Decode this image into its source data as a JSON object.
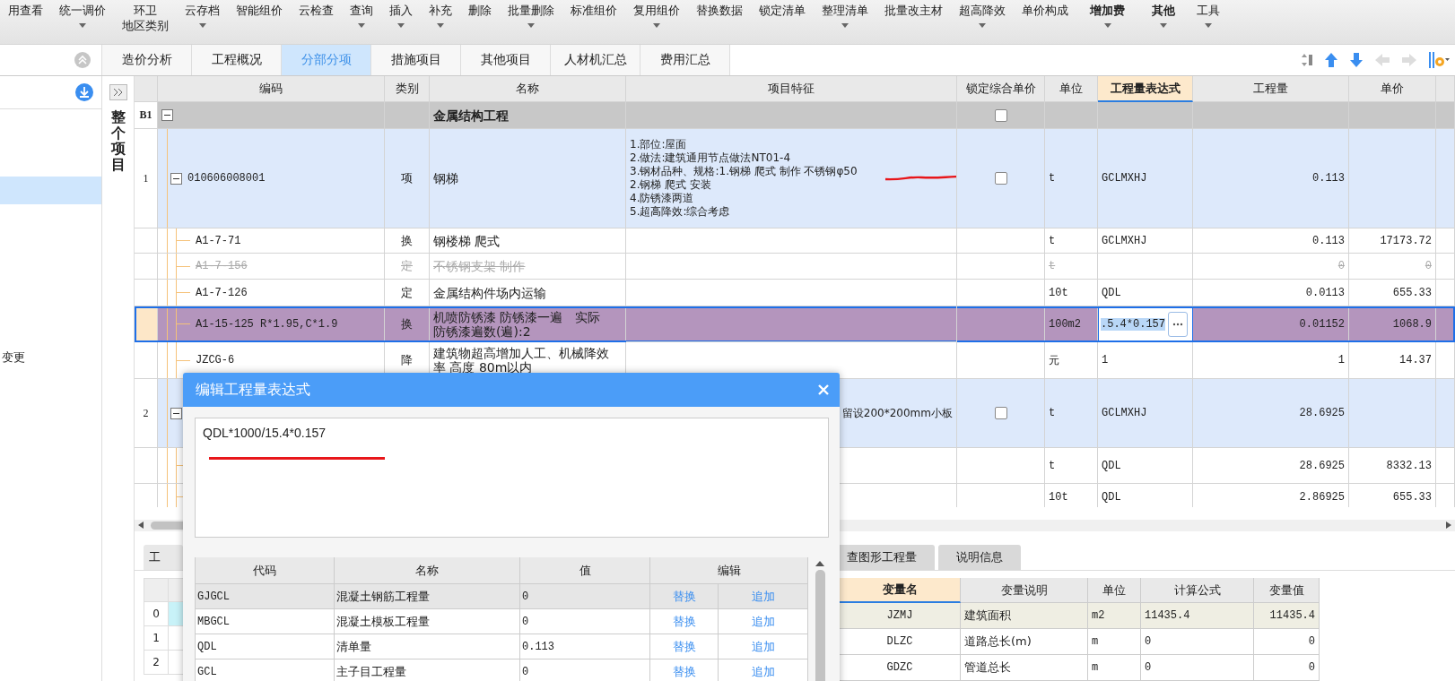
{
  "toolbar": [
    {
      "label": "用查看",
      "caret": false,
      "bold": false
    },
    {
      "label": "统一调价",
      "caret": true,
      "bold": false
    },
    {
      "label": "环卫",
      "sublabel": "地区类别",
      "caret": false,
      "bold": false
    },
    {
      "label": "云存档",
      "caret": true,
      "bold": false
    },
    {
      "label": "智能组价",
      "caret": false,
      "bold": false
    },
    {
      "label": "云检查",
      "caret": false,
      "bold": false
    },
    {
      "label": "查询",
      "caret": true,
      "bold": false
    },
    {
      "label": "插入",
      "caret": true,
      "bold": false
    },
    {
      "label": "补充",
      "caret": true,
      "bold": false
    },
    {
      "label": "删除",
      "caret": false,
      "bold": false
    },
    {
      "label": "批量删除",
      "caret": true,
      "bold": false
    },
    {
      "label": "标准组价",
      "caret": false,
      "bold": false
    },
    {
      "label": "复用组价",
      "caret": true,
      "bold": false
    },
    {
      "label": "替换数据",
      "caret": false,
      "bold": false
    },
    {
      "label": "锁定清单",
      "caret": false,
      "bold": false
    },
    {
      "label": "整理清单",
      "caret": true,
      "bold": false
    },
    {
      "label": "批量改主材",
      "caret": false,
      "bold": false
    },
    {
      "label": "超高降效",
      "caret": true,
      "bold": false
    },
    {
      "label": "单价构成",
      "caret": false,
      "bold": false
    },
    {
      "label": "增加费",
      "caret": true,
      "bold": true
    },
    {
      "label": "其他",
      "caret": true,
      "bold": true
    },
    {
      "label": "工具",
      "caret": true,
      "bold": false
    }
  ],
  "tabs": [
    {
      "label": "造价分析",
      "selected": false
    },
    {
      "label": "工程概况",
      "selected": false
    },
    {
      "label": "分部分项",
      "selected": true
    },
    {
      "label": "措施项目",
      "selected": false
    },
    {
      "label": "其他项目",
      "selected": false
    },
    {
      "label": "人材机汇总",
      "selected": false
    },
    {
      "label": "费用汇总",
      "selected": false
    }
  ],
  "sidebar": {
    "cut_label": "变更"
  },
  "side_strip": {
    "title": "整个项目"
  },
  "table": {
    "columns": [
      "编码",
      "类别",
      "名称",
      "项目特征",
      "锁定综合单价",
      "单位",
      "工程量表达式",
      "工程量",
      "单价"
    ],
    "rows": [
      {
        "kind": "section",
        "num": "B1",
        "expanded": true,
        "name": "金属结构工程",
        "locked": false,
        "selected": false
      },
      {
        "kind": "item",
        "num": "1",
        "expanded": true,
        "code": "010606008001",
        "cat": "项",
        "name": "钢梯",
        "features": [
          "1.部位:屋面",
          "2.做法:建筑通用节点做法NT01-4",
          "3.钢材品种、规格:1.钢梯 爬式 制作 不锈钢φ50",
          "2.钢梯 爬式 安装",
          "4.防锈漆两道",
          "5.超高降效:综合考虑"
        ],
        "locked": false,
        "unit": "t",
        "expr": "GCLMXHJ",
        "qty": "0.113",
        "selected": false
      },
      {
        "kind": "sub",
        "code": "A1-7-71",
        "cat": "换",
        "name": "钢楼梯 爬式",
        "unit": "t",
        "expr": "GCLMXHJ",
        "qty": "0.113",
        "price": "17173.72",
        "struck": false,
        "selected": false
      },
      {
        "kind": "sub",
        "code": "A1-7-156",
        "cat": "定",
        "name": "不锈钢支架 制作",
        "unit": "t",
        "qty": "0",
        "price": "0",
        "struck": true,
        "selected": false
      },
      {
        "kind": "sub",
        "code": "A1-7-126",
        "cat": "定",
        "name": "金属结构件场内运输",
        "unit": "10t",
        "expr": "QDL",
        "qty": "0.0113",
        "price": "655.33",
        "struck": false,
        "selected": false
      },
      {
        "kind": "sub",
        "code": "A1-15-125 R*1.95,C*1.9",
        "cat": "换",
        "name": "机喷防锈漆 防锈漆一遍　实际防锈漆遍数(遍):2",
        "unit": "100m2",
        "expr": ".5.4*0.157",
        "editing": true,
        "qty": "0.01152",
        "price": "1068.9",
        "struck": false,
        "selected": true
      },
      {
        "kind": "sub",
        "code": "JZCG-6",
        "cat": "降",
        "name": "建筑物超高增加人工、机械降效率 高度 80m以内",
        "unit": "元",
        "expr": "1",
        "qty": "1",
        "price": "14.37",
        "struck": false,
        "selected": false
      },
      {
        "kind": "item",
        "num": "2",
        "expanded": true,
        "features_tail": "留设200*200mm小板",
        "locked": false,
        "unit": "t",
        "expr": "GCLMXHJ",
        "qty": "28.6925",
        "selected": false
      },
      {
        "kind": "sub",
        "unit": "t",
        "expr": "QDL",
        "qty": "28.6925",
        "price": "8332.13",
        "struck": false,
        "selected": false
      },
      {
        "kind": "sub",
        "unit": "10t",
        "expr": "QDL",
        "qty": "2.86925",
        "price": "655.33",
        "struck": false,
        "selected": false
      }
    ]
  },
  "bottom": {
    "tabs": [
      {
        "label": "工",
        "selected": true
      },
      {
        "label": "查图形工程量",
        "selected": false
      },
      {
        "label": "说明信息",
        "selected": false
      }
    ],
    "grid_rows": [
      "0",
      "1",
      "2"
    ],
    "variables": {
      "columns": [
        "变量名",
        "变量说明",
        "单位",
        "计算公式",
        "变量值"
      ],
      "rows": [
        {
          "name": "JZMJ",
          "desc": "建筑面积",
          "unit": "m2",
          "formula": "11435.4",
          "value": "11435.4",
          "selected": true
        },
        {
          "name": "DLZC",
          "desc": "道路总长(m)",
          "unit": "m",
          "formula": "0",
          "value": "0",
          "selected": false
        },
        {
          "name": "GDZC",
          "desc": "管道总长",
          "unit": "m",
          "formula": "0",
          "value": "0",
          "selected": false
        }
      ]
    }
  },
  "dialog": {
    "title": "编辑工程量表达式",
    "expression": "QDL*1000/15.4*0.157",
    "columns": [
      "代码",
      "名称",
      "值",
      "编辑"
    ],
    "rows": [
      {
        "code": "GJGCL",
        "name": "混凝土钢筋工程量",
        "value": "0",
        "replace": "替换",
        "append": "追加",
        "selected": true
      },
      {
        "code": "MBGCL",
        "name": "混凝土模板工程量",
        "value": "0",
        "replace": "替换",
        "append": "追加",
        "selected": false
      },
      {
        "code": "QDL",
        "name": "清单量",
        "value": "0.113",
        "replace": "替换",
        "append": "追加",
        "selected": false
      },
      {
        "code": "GCL",
        "name": "主子目工程量",
        "value": "0",
        "replace": "替换",
        "append": "追加",
        "selected": false
      }
    ]
  }
}
